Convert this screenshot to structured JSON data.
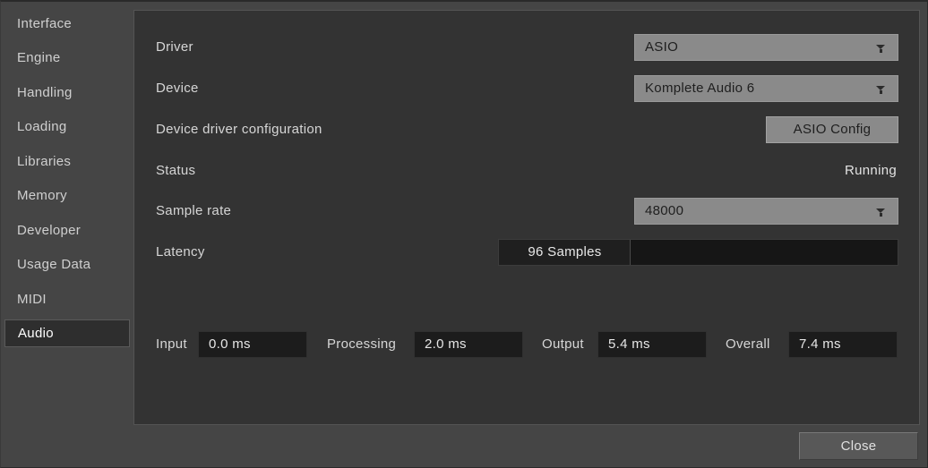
{
  "sidebar": {
    "items": [
      {
        "label": "Interface",
        "selected": false
      },
      {
        "label": "Engine",
        "selected": false
      },
      {
        "label": "Handling",
        "selected": false
      },
      {
        "label": "Loading",
        "selected": false
      },
      {
        "label": "Libraries",
        "selected": false
      },
      {
        "label": "Memory",
        "selected": false
      },
      {
        "label": "Developer",
        "selected": false
      },
      {
        "label": "Usage Data",
        "selected": false
      },
      {
        "label": "MIDI",
        "selected": false
      },
      {
        "label": "Audio",
        "selected": true
      }
    ]
  },
  "audio": {
    "driver": {
      "label": "Driver",
      "value": "ASIO",
      "control": "dropdown",
      "arrow_icon": "chevron-down-icon"
    },
    "device": {
      "label": "Device",
      "value": "Komplete Audio 6",
      "control": "dropdown",
      "arrow_icon": "chevron-down-icon"
    },
    "device_driver_configuration": {
      "label": "Device driver configuration",
      "button_label": "ASIO Config"
    },
    "status": {
      "label": "Status",
      "value": "Running"
    },
    "sample_rate": {
      "label": "Sample rate",
      "value": "48000",
      "control": "dropdown",
      "arrow_icon": "chevron-down-icon"
    },
    "latency": {
      "label": "Latency",
      "value": "96 Samples",
      "control": "slider"
    },
    "stats": [
      {
        "label": "Input",
        "value": "0.0 ms"
      },
      {
        "label": "Processing",
        "value": "2.0 ms"
      },
      {
        "label": "Output",
        "value": "5.4 ms"
      },
      {
        "label": "Overall",
        "value": "7.4 ms"
      }
    ]
  },
  "footer": {
    "close_label": "Close"
  },
  "colors": {
    "window_background": "#454545",
    "panel_background": "#333333",
    "dropdown_fill": "#8a8a8a",
    "dark_field": "#1c1c1c",
    "selected_item": "#2e2e2e",
    "text_primary": "#d8d8d8"
  }
}
